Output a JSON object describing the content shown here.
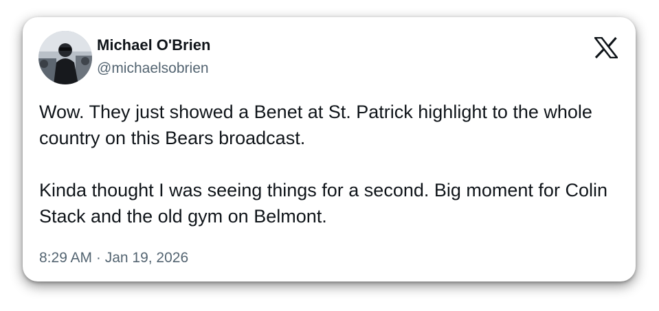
{
  "author": {
    "name": "Michael O'Brien",
    "handle": "@michaelsobrien"
  },
  "icons": {
    "avatar": "profile-photo",
    "platform": "x-logo-icon"
  },
  "tweet": {
    "paragraphs": [
      "Wow. They just showed a Benet at St. Patrick highlight to the whole country on this Bears broadcast.",
      "Kinda thought I was seeing things for a second. Big moment for Colin Stack and the old gym on Belmont."
    ],
    "timestamp": "8:29 AM · Jan 19, 2026"
  },
  "colors": {
    "text_primary": "#0f1419",
    "text_secondary": "#536471",
    "card_background": "#ffffff"
  }
}
